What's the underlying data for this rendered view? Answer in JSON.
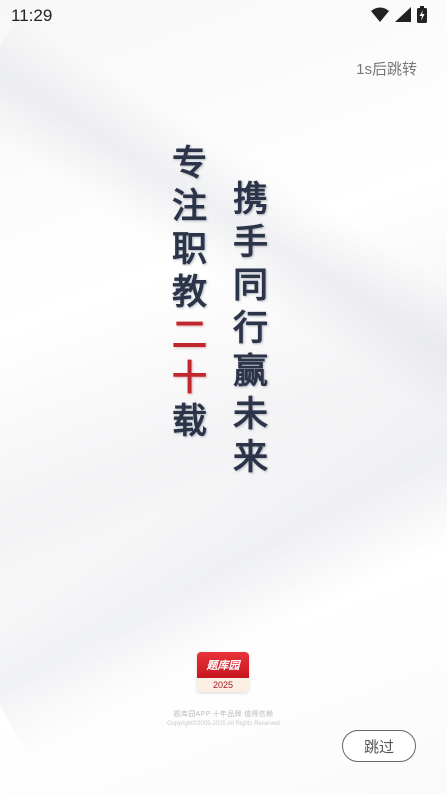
{
  "status_bar": {
    "time": "11:29",
    "icons": [
      "wifi-icon",
      "signal-icon",
      "battery-charging-icon"
    ]
  },
  "countdown_text": "1s后跳转",
  "slogan": {
    "left_column": [
      "专",
      "注",
      "职",
      "教",
      "二",
      "十",
      "载"
    ],
    "left_column_red_chars": [
      "二",
      "十"
    ],
    "right_column": [
      "携",
      "手",
      "同",
      "行",
      "赢",
      "未",
      "来"
    ]
  },
  "logo": {
    "name": "题库园",
    "year": "2025"
  },
  "footer": {
    "line1": "题库园APP  十年品牌  值得信赖",
    "line2": "Copyright©2005-2025 All Rights Reserved"
  },
  "skip_button_label": "跳过",
  "colors": {
    "slogan_text": "#2b3448",
    "accent_red": "#c0272d",
    "logo_red": "#d8222a"
  }
}
